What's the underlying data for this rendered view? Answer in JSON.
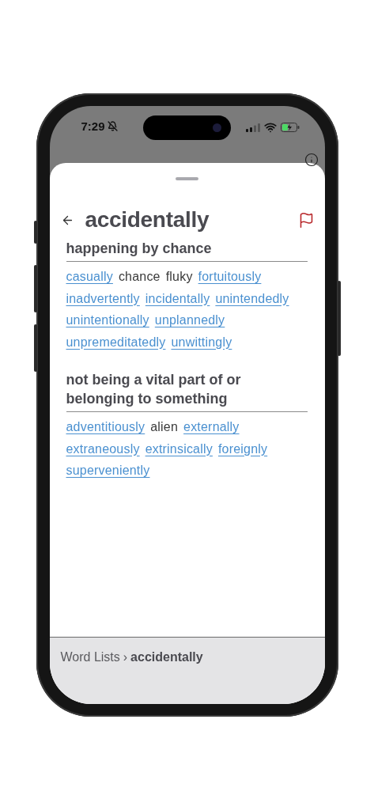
{
  "status_bar": {
    "time": "7:29",
    "silent": true
  },
  "header": {
    "title": "accidentally",
    "flagged": false
  },
  "senses": [
    {
      "heading": "happening by chance",
      "words": [
        {
          "text": "casually",
          "kind": "link"
        },
        {
          "text": "chance",
          "kind": "plain"
        },
        {
          "text": "fluky",
          "kind": "plain"
        },
        {
          "text": "fortuitously",
          "kind": "link"
        },
        {
          "text": "inadvertently",
          "kind": "link"
        },
        {
          "text": "incidentally",
          "kind": "link"
        },
        {
          "text": "unintendedly",
          "kind": "link"
        },
        {
          "text": "unintentionally",
          "kind": "link"
        },
        {
          "text": "unplannedly",
          "kind": "link"
        },
        {
          "text": "unpremeditatedly",
          "kind": "link"
        },
        {
          "text": "unwittingly",
          "kind": "link"
        }
      ]
    },
    {
      "heading": "not being a vital part of or belonging to something",
      "words": [
        {
          "text": "adventitiously",
          "kind": "link"
        },
        {
          "text": "alien",
          "kind": "plain"
        },
        {
          "text": "externally",
          "kind": "link"
        },
        {
          "text": "extraneously",
          "kind": "link"
        },
        {
          "text": "extrinsically",
          "kind": "link"
        },
        {
          "text": "foreignly",
          "kind": "link"
        },
        {
          "text": "superveniently",
          "kind": "link"
        }
      ]
    }
  ],
  "breadcrumb": {
    "parent": "Word Lists",
    "separator": "›",
    "current": "accidentally"
  }
}
